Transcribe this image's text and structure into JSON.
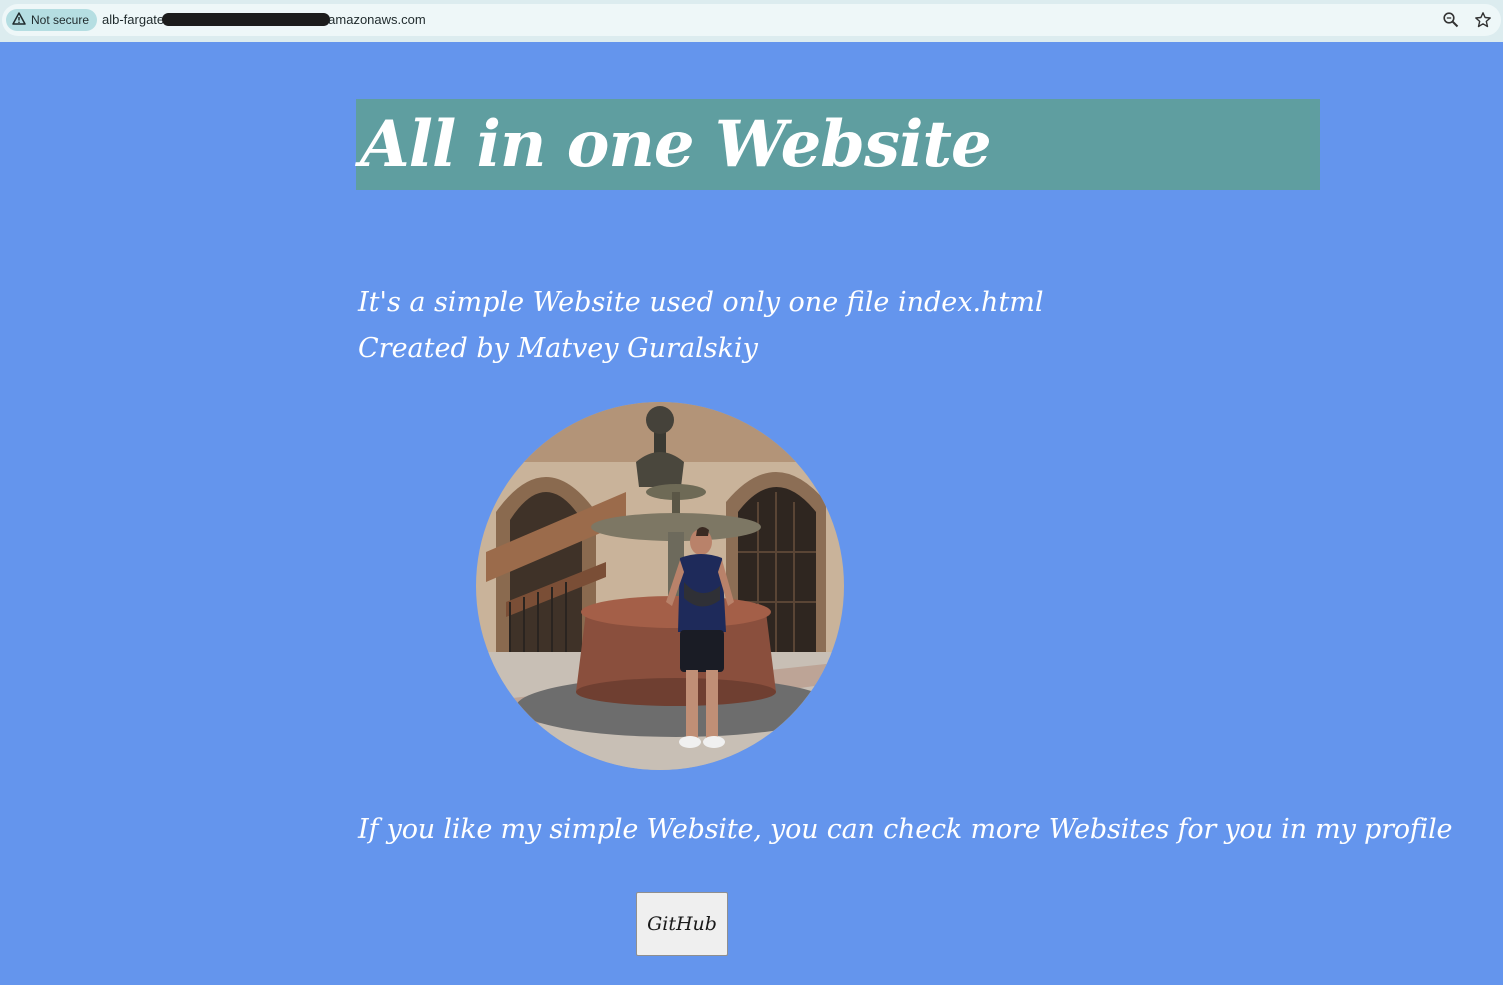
{
  "browser": {
    "security_label": "Not secure",
    "url_prefix": "alb-fargate",
    "url_suffix": "amazonaws.com",
    "icons": [
      "warning-triangle-icon",
      "zoom-icon",
      "bookmark-star-icon"
    ]
  },
  "page": {
    "title": "All in one Website",
    "intro_lines": [
      "It's a simple Website used only one file index.html",
      "Created by Matvey Guralskiy"
    ],
    "cta_text": "If you like my simple Website, you can check more Websites for you in my profile",
    "github_button_label": "GitHub"
  },
  "colors": {
    "background": "#6495ed",
    "header_band": "#5f9ea0",
    "text": "#ffffff"
  }
}
